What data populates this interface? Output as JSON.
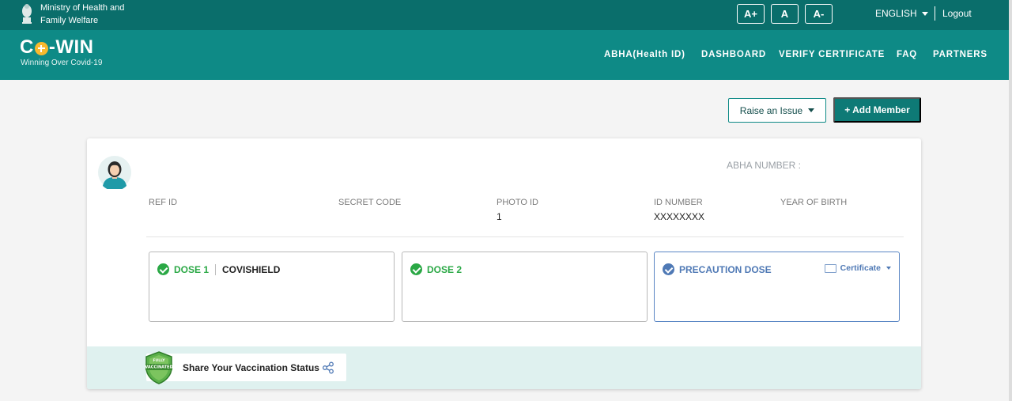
{
  "header": {
    "ministry_line1": "Ministry of Health and",
    "ministry_line2": "Family Welfare",
    "font_buttons": [
      "A+",
      "A",
      "A-"
    ],
    "language": "ENGLISH",
    "logout": "Logout"
  },
  "brand": {
    "logo_left": "C",
    "logo_right": "-WIN",
    "tagline": "Winning Over Covid-19",
    "accent_yellow": "#f7b92e",
    "teal_dark": "#0a6e6b",
    "teal": "#0e8a86"
  },
  "nav": {
    "items": [
      "ABHA(Health ID)",
      "DASHBOARD",
      "VERIFY CERTIFICATE",
      "FAQ",
      "PARTNERS"
    ]
  },
  "actions": {
    "raise_issue": "Raise an Issue",
    "add_member": "+ Add Member"
  },
  "profile": {
    "abha_label": "ABHA NUMBER :",
    "fields": [
      {
        "label": "REF ID",
        "value": ""
      },
      {
        "label": "SECRET CODE",
        "value": ""
      },
      {
        "label": "PHOTO ID",
        "value": "1"
      },
      {
        "label": "ID NUMBER",
        "value": "XXXXXXXX"
      },
      {
        "label": "YEAR OF BIRTH",
        "value": ""
      }
    ]
  },
  "doses": [
    {
      "title": "DOSE 1",
      "vaccine": "COVISHIELD",
      "status_color": "#2aa845"
    },
    {
      "title": "DOSE 2",
      "vaccine": "",
      "status_color": "#2aa845"
    },
    {
      "title": "PRECAUTION DOSE",
      "vaccine": "",
      "status_color": "#4f79b5",
      "certificate_label": "Certificate"
    }
  ],
  "share": {
    "label": "Share Your Vaccination Status",
    "badge_line1": "FULLY",
    "badge_line2": "VACCINATED"
  }
}
